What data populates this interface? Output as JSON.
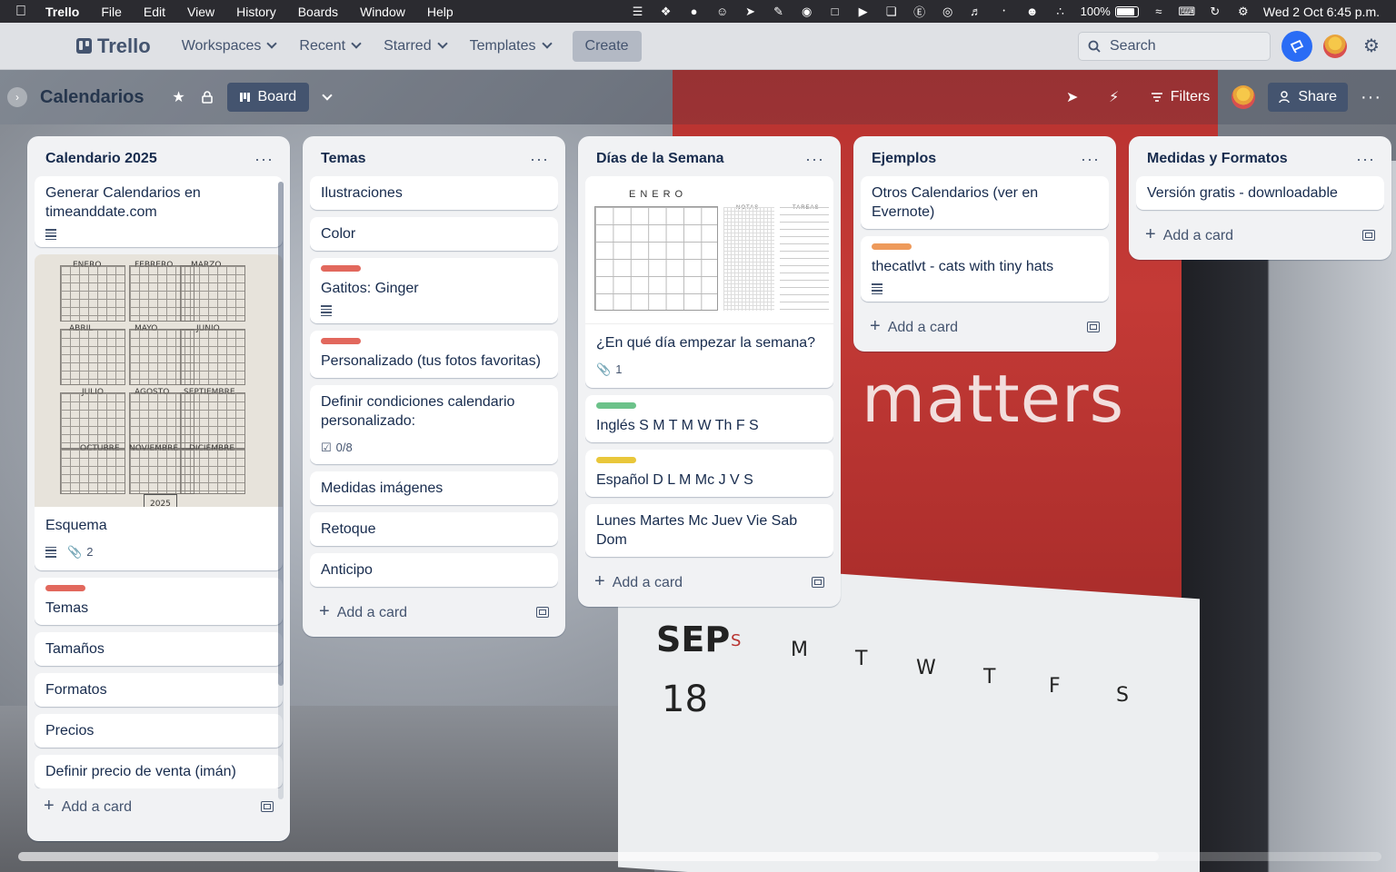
{
  "menubar": {
    "app_name": "Trello",
    "menus": [
      "File",
      "Edit",
      "View",
      "History",
      "Boards",
      "Window",
      "Help"
    ],
    "battery": "100%",
    "clock": "Wed 2 Oct  6:45 p.m."
  },
  "header": {
    "logo": "Trello",
    "nav": [
      "Workspaces",
      "Recent",
      "Starred",
      "Templates"
    ],
    "create_label": "Create",
    "search_placeholder": "Search"
  },
  "board": {
    "title": "Calendarios",
    "view_label": "Board",
    "filters_label": "Filters",
    "share_label": "Share"
  },
  "lists": [
    {
      "title": "Calendario 2025",
      "add_label": "Add a card",
      "cards": [
        {
          "title": "Generar Calendarios en timeanddate.com",
          "has_description": true
        },
        {
          "title": "Esquema",
          "cover": "sketch",
          "has_description": true,
          "attachments": "2"
        },
        {
          "title": "Temas",
          "label_color": "#e2685d"
        },
        {
          "title": "Tamaños"
        },
        {
          "title": "Formatos"
        },
        {
          "title": "Precios"
        },
        {
          "title": "Definir precio de venta (imán)"
        }
      ]
    },
    {
      "title": "Temas",
      "add_label": "Add a card",
      "cards": [
        {
          "title": "Ilustraciones"
        },
        {
          "title": "Color"
        },
        {
          "title": "Gatitos: Ginger",
          "label_color": "#e2685d",
          "has_description": true
        },
        {
          "title": "Personalizado (tus fotos favoritas)",
          "label_color": "#e2685d"
        },
        {
          "title": "Definir condiciones calendario personalizado:",
          "checklist": "0/8"
        },
        {
          "title": "Medidas imágenes"
        },
        {
          "title": "Retoque"
        },
        {
          "title": "Anticipo"
        }
      ]
    },
    {
      "title": "Días de la Semana",
      "add_label": "Add a card",
      "cards": [
        {
          "title": "¿En qué día empezar la semana?",
          "cover": "enero",
          "attachments": "1"
        },
        {
          "title": "Inglés S M T M W Th F S",
          "label_color": "#6cc28a"
        },
        {
          "title": "Español D L M Mc J V S",
          "label_color": "#e9c73a"
        },
        {
          "title": "Lunes Martes Mc Juev Vie Sab Dom"
        }
      ]
    },
    {
      "title": "Ejemplos",
      "add_label": "Add a card",
      "cards": [
        {
          "title": "Otros Calendarios (ver en Evernote)"
        },
        {
          "title": "thecatlvt - cats with tiny hats",
          "label_color": "#ee9a5b",
          "has_description": true
        }
      ]
    },
    {
      "title": "Medidas y Formatos",
      "add_label": "Add a card",
      "cards": [
        {
          "title": "Versión gratis - downloadable"
        }
      ]
    }
  ],
  "covers": {
    "sketch_months": [
      "ENERO",
      "FEBRERO",
      "MARZO",
      "ABRIL",
      "MAYO",
      "JUNIO",
      "JULIO",
      "AGOSTO",
      "SEPTIEMBRE",
      "OCTUBRE",
      "NOVIEMBRE",
      "DICIEMBRE"
    ],
    "sketch_year": "2025",
    "enero_title": "ENERO",
    "enero_notes": "NOTAS",
    "enero_tasks": "TAREAS"
  },
  "background_photo": {
    "slogan": "matters",
    "month": "SEP",
    "big_date": "18",
    "weekdays": [
      "S",
      "M",
      "T",
      "W",
      "T",
      "F",
      "S"
    ]
  }
}
